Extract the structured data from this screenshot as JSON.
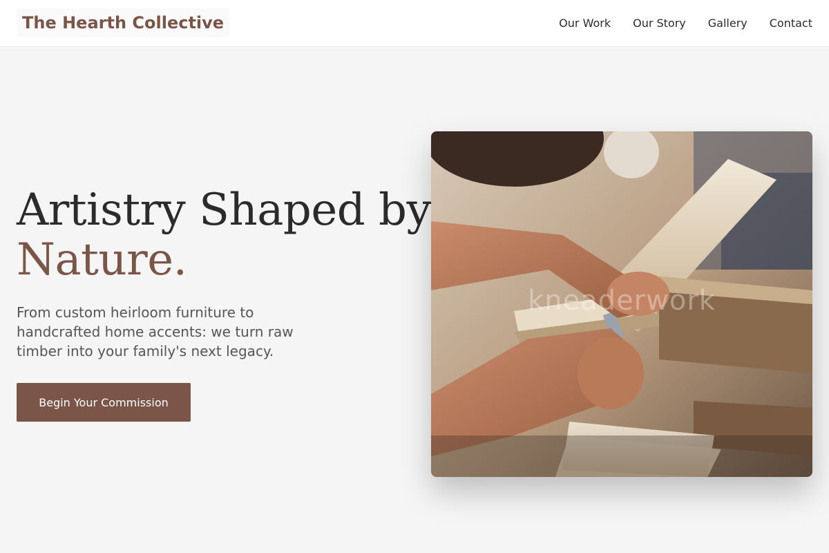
{
  "brand": {
    "name": "The Hearth Collective"
  },
  "nav": {
    "items": [
      {
        "label": "Our Work"
      },
      {
        "label": "Our Story"
      },
      {
        "label": "Gallery"
      },
      {
        "label": "Contact"
      }
    ]
  },
  "hero": {
    "title_line1": "Artistry Shaped by",
    "title_line2": "Nature.",
    "subtitle": "From custom heirloom furniture to handcrafted home accents: we turn raw timber into your family's next legacy.",
    "cta_label": "Begin Your Commission",
    "image": {
      "subject": "craftsman measuring wooden plank with caliper",
      "watermark": "kneaderwork"
    }
  },
  "colors": {
    "brand": "#7a5548",
    "background": "#f5f5f5",
    "nav_background": "#ffffff",
    "heading_text": "#2b2b2b",
    "body_text": "#555555",
    "button_background": "#7a5548",
    "button_text": "#ffffff"
  }
}
